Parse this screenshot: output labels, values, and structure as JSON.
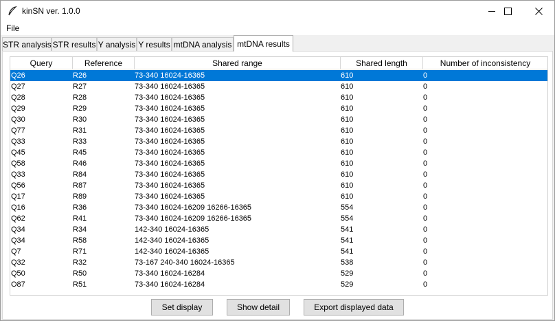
{
  "window": {
    "title": "kinSN ver. 1.0.0",
    "minimize_icon": "minimize-icon",
    "maximize_icon": "maximize-icon",
    "close_icon": "close-icon"
  },
  "menu": {
    "file": "File"
  },
  "tabs": [
    {
      "label": "STR analysis",
      "active": false
    },
    {
      "label": "STR results",
      "active": false
    },
    {
      "label": "Y analysis",
      "active": false
    },
    {
      "label": "Y results",
      "active": false
    },
    {
      "label": "mtDNA analysis",
      "active": false
    },
    {
      "label": "mtDNA results",
      "active": true
    }
  ],
  "table": {
    "columns": [
      "Query",
      "Reference",
      "Shared range",
      "Shared length",
      "Number of inconsistency"
    ],
    "selected_row": 0,
    "rows": [
      [
        "Q26",
        "R26",
        "73-340 16024-16365",
        "610",
        "0"
      ],
      [
        "Q27",
        "R27",
        "73-340 16024-16365",
        "610",
        "0"
      ],
      [
        "Q28",
        "R28",
        "73-340 16024-16365",
        "610",
        "0"
      ],
      [
        "Q29",
        "R29",
        "73-340 16024-16365",
        "610",
        "0"
      ],
      [
        "Q30",
        "R30",
        "73-340 16024-16365",
        "610",
        "0"
      ],
      [
        "Q77",
        "R31",
        "73-340 16024-16365",
        "610",
        "0"
      ],
      [
        "Q33",
        "R33",
        "73-340 16024-16365",
        "610",
        "0"
      ],
      [
        "Q45",
        "R45",
        "73-340 16024-16365",
        "610",
        "0"
      ],
      [
        "Q58",
        "R46",
        "73-340 16024-16365",
        "610",
        "0"
      ],
      [
        "Q33",
        "R84",
        "73-340 16024-16365",
        "610",
        "0"
      ],
      [
        "Q56",
        "R87",
        "73-340 16024-16365",
        "610",
        "0"
      ],
      [
        "Q17",
        "R89",
        "73-340 16024-16365",
        "610",
        "0"
      ],
      [
        "Q16",
        "R36",
        "73-340 16024-16209 16266-16365",
        "554",
        "0"
      ],
      [
        "Q62",
        "R41",
        "73-340 16024-16209 16266-16365",
        "554",
        "0"
      ],
      [
        "Q34",
        "R34",
        "142-340 16024-16365",
        "541",
        "0"
      ],
      [
        "Q34",
        "R58",
        "142-340 16024-16365",
        "541",
        "0"
      ],
      [
        "Q7",
        "R71",
        "142-340 16024-16365",
        "541",
        "0"
      ],
      [
        "Q32",
        "R32",
        "73-167 240-340 16024-16365",
        "538",
        "0"
      ],
      [
        "Q50",
        "R50",
        "73-340 16024-16284",
        "529",
        "0"
      ],
      [
        "O87",
        "R51",
        "73-340 16024-16284",
        "529",
        "0"
      ]
    ]
  },
  "buttons": {
    "set_display": "Set display",
    "show_detail": "Show detail",
    "export": "Export displayed data"
  },
  "colors": {
    "selection": "#0078d7"
  }
}
